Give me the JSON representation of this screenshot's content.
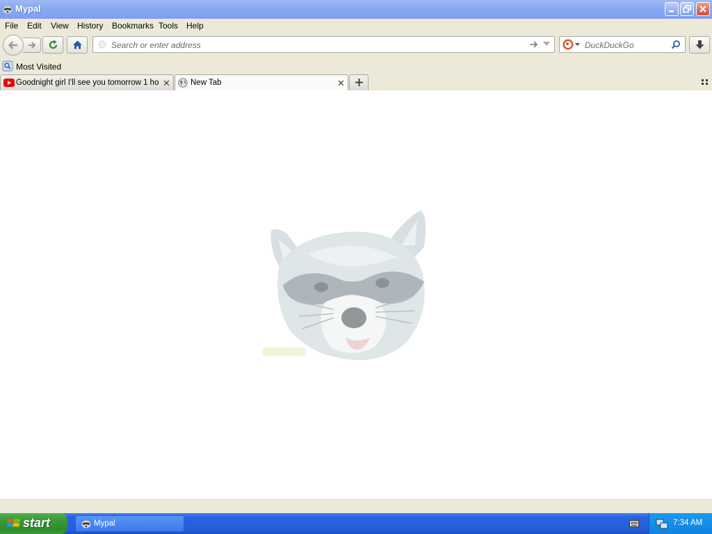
{
  "window": {
    "title": "Mypal"
  },
  "menu": {
    "items": [
      {
        "label": "File"
      },
      {
        "label": "Edit"
      },
      {
        "label": "View"
      },
      {
        "label": "History"
      },
      {
        "label": "Bookmarks"
      },
      {
        "label": "Tools"
      },
      {
        "label": "Help"
      }
    ]
  },
  "navbar": {
    "address_placeholder": "Search or enter address",
    "search_placeholder": "DuckDuckGo"
  },
  "bookmarks": {
    "most_visited": "Most Visited"
  },
  "tabs": [
    {
      "label": "Goodnight girl I'll see you tomorrow 1 ho...",
      "icon": "youtube-icon",
      "active": false
    },
    {
      "label": "New Tab",
      "icon": "globe-icon",
      "active": true
    }
  ],
  "taskbar": {
    "start_label": "start",
    "task_label": "Mypal",
    "clock": "7:34 AM"
  },
  "colors": {
    "titlebar": "#8aa9f2",
    "chrome": "#ece9d8",
    "taskbar": "#245edb",
    "start": "#3c9a3c",
    "tray": "#0f82e0"
  }
}
